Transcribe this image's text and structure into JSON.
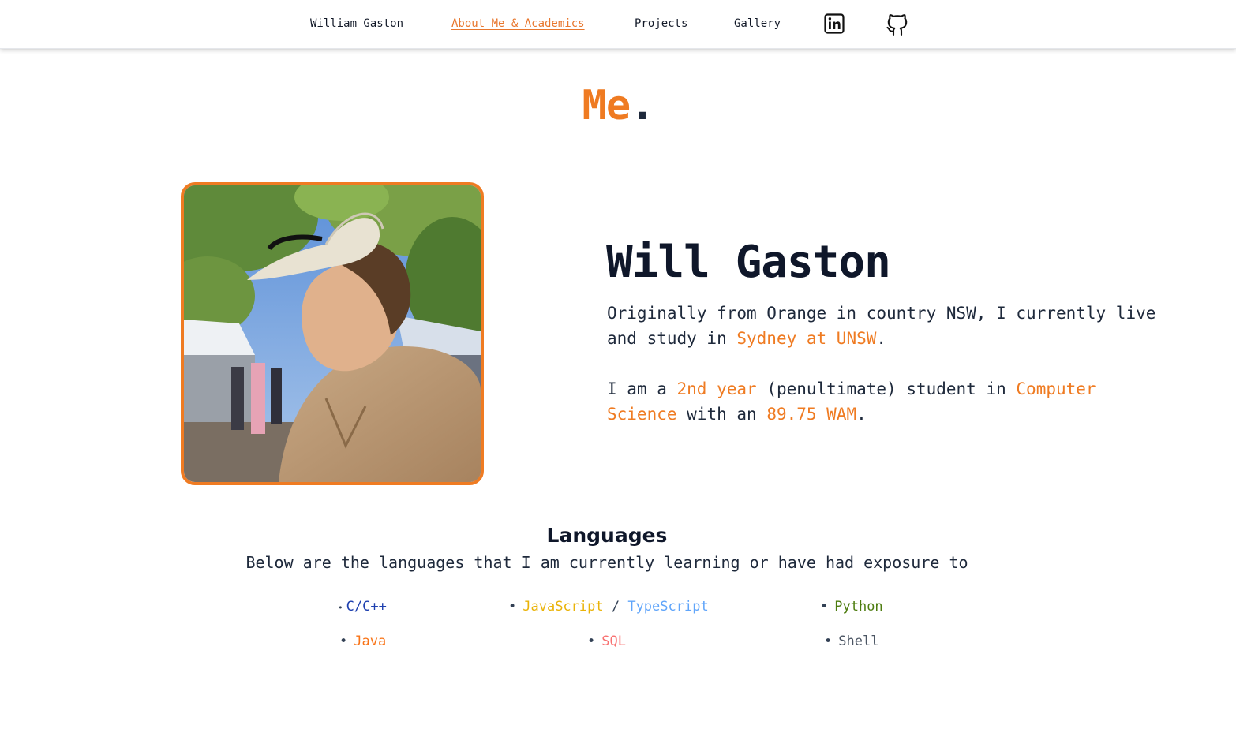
{
  "nav": {
    "items": [
      {
        "label": "William Gaston"
      },
      {
        "label": "About Me & Academics",
        "active": true
      },
      {
        "label": "Projects"
      },
      {
        "label": "Gallery"
      }
    ],
    "icons": [
      "linkedin-icon",
      "github-icon"
    ]
  },
  "page_title": {
    "word": "Me",
    "dot": "."
  },
  "photo": {
    "icon": "profile-photo",
    "border_color": "#ef7b22"
  },
  "bio": {
    "name": "Will Gaston",
    "p1_a": "Originally from Orange in country NSW, I currently live and study in ",
    "p1_hl": "Sydney at UNSW",
    "p1_b": ".",
    "p2_a": "I am a ",
    "p2_hl1": "2nd year",
    "p2_b": " (penultimate) student in ",
    "p2_hl2": "Computer Science",
    "p2_c": " with an ",
    "p2_hl3": "89.75 WAM",
    "p2_d": "."
  },
  "languages": {
    "title": "Languages",
    "subtitle": "Below are the languages that I am currently learning or have had exposure to",
    "bullet": "•",
    "separator": "/",
    "items": [
      {
        "label": "C/C++",
        "color": "#1e40af"
      },
      {
        "label": "JavaScript",
        "color": "#eab308"
      },
      {
        "label": "TypeScript",
        "color": "#60a5fa"
      },
      {
        "label": "Python",
        "color": "#4d7c0f"
      },
      {
        "label": "Java",
        "color": "#f97316"
      },
      {
        "label": "SQL",
        "color": "#f87171"
      },
      {
        "label": "Shell",
        "color": "#4b5563"
      }
    ]
  },
  "colors": {
    "accent": "#ef7b22",
    "text": "#1e293b"
  }
}
